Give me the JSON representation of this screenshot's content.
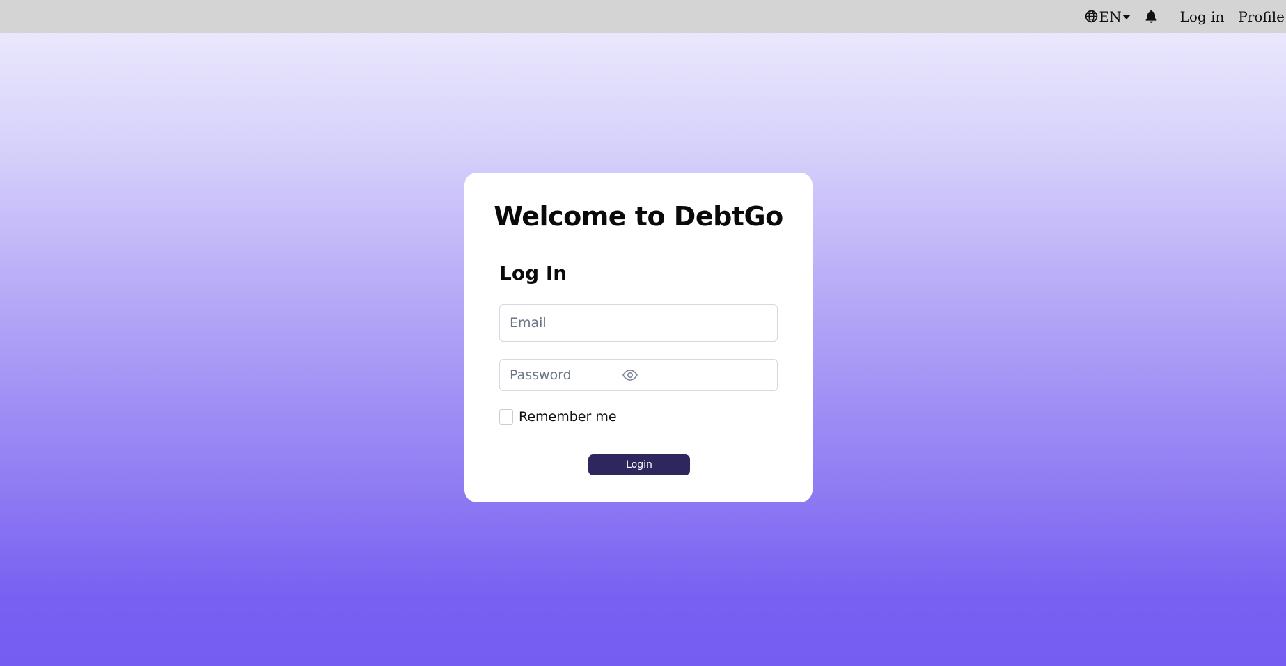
{
  "header": {
    "language_label": "EN",
    "login_link": "Log in",
    "profile_link": "Profile"
  },
  "card": {
    "title": "Welcome to DebtGo",
    "heading": "Log In",
    "email_placeholder": "Email",
    "password_placeholder": "Password",
    "remember_label": "Remember me",
    "login_button": "Login"
  },
  "icons": {
    "language": "globe-icon",
    "language_dropdown": "caret-down-icon",
    "notifications": "bell-icon",
    "password_toggle": "eye-icon"
  },
  "colors": {
    "topbar": "#d4d4d4",
    "background_top": "#efedfe",
    "background_bottom": "#755df2",
    "card": "#ffffff",
    "primary_button": "#2e275e",
    "placeholder": "#6b7585"
  }
}
